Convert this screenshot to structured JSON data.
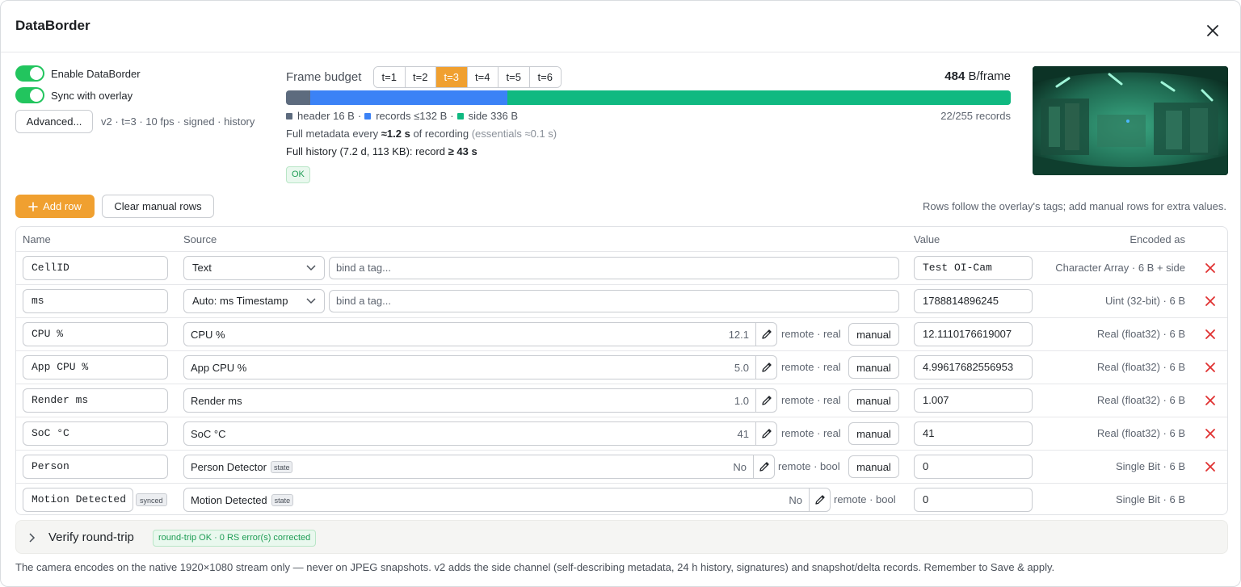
{
  "dialog": {
    "title": "DataBorder"
  },
  "toggles": {
    "enable_label": "Enable DataBorder",
    "sync_label": "Sync with overlay"
  },
  "advanced": {
    "button_label": "Advanced...",
    "summary": "v2 · t=3 · 10 fps · signed · history"
  },
  "frame_budget": {
    "label": "Frame budget",
    "tiers": [
      "t=1",
      "t=2",
      "t=3",
      "t=4",
      "t=5",
      "t=6"
    ],
    "selected_tier": "t=3",
    "total_value": "484",
    "total_unit": "B/frame",
    "bar_fractions": {
      "header": 0.033,
      "records": 0.273,
      "side": 0.694
    },
    "colors": {
      "header": "#5d6b7e",
      "records": "#3b82f6",
      "side": "#10b981"
    },
    "legend": {
      "header": "header 16 B",
      "records": "records ≤132 B",
      "side": "side 336 B"
    },
    "record_count": "22/255 records",
    "meta_prefix": "Full metadata every ",
    "meta_value": "≈1.2 s",
    "meta_mid": " of recording ",
    "meta_muted": "(essentials ≈0.1 s)",
    "history_prefix": "Full history (7.2 d, 113 KB): record ",
    "history_value": "≥ 43 s",
    "status": "OK"
  },
  "toolbar": {
    "add_label": "Add row",
    "clear_label": "Clear manual rows",
    "hint": "Rows follow the overlay's tags; add manual rows for extra values."
  },
  "table": {
    "headers": {
      "name": "Name",
      "source": "Source",
      "value": "Value",
      "encoded": "Encoded as"
    },
    "rows": [
      {
        "name": "CellID",
        "source": "Text",
        "bind_placeholder": "bind a tag...",
        "value": "Test OI-Cam",
        "encoded": "Character Array · 6 B + side"
      },
      {
        "name": "ms",
        "source": "Auto: ms Timestamp",
        "bind_placeholder": "bind a tag...",
        "value": "1788814896245",
        "encoded": "Uint (32-bit) · 6 B"
      },
      {
        "name": "CPU %",
        "source": "CPU %",
        "source_value": "12.1",
        "meta": "remote · real",
        "manual": "manual",
        "value": "12.1110176619007",
        "encoded": "Real (float32) · 6 B"
      },
      {
        "name": "App CPU %",
        "source": "App CPU %",
        "source_value": "5.0",
        "meta": "remote · real",
        "manual": "manual",
        "value": "4.99617682556953",
        "encoded": "Real (float32) · 6 B"
      },
      {
        "name": "Render ms",
        "source": "Render ms",
        "source_value": "1.0",
        "meta": "remote · real",
        "manual": "manual",
        "value": "1.007",
        "encoded": "Real (float32) · 6 B"
      },
      {
        "name": "SoC °C",
        "source": "SoC °C",
        "source_value": "41",
        "meta": "remote · real",
        "manual": "manual",
        "value": "41",
        "encoded": "Real (float32) · 6 B"
      },
      {
        "name": "Person",
        "source": "Person Detector",
        "state": "state",
        "source_value": "No",
        "meta": "remote · bool",
        "manual": "manual",
        "value": "0",
        "encoded": "Single Bit · 6 B"
      },
      {
        "name": "Motion Detected",
        "synced": "synced",
        "source": "Motion Detected",
        "state": "state",
        "source_value": "No",
        "meta": "remote · bool",
        "value": "0",
        "encoded": "Single Bit · 6 B"
      }
    ]
  },
  "verify": {
    "title": "Verify round-trip",
    "badge": "round-trip OK · 0 RS error(s) corrected"
  },
  "footnote": "The camera encodes on the native 1920×1080 stream only — never on JPEG snapshots. v2 adds the side channel (self-describing metadata, 24 h history, signatures) and snapshot/delta records. Remember to Save & apply.",
  "colors": {
    "accent": "#f0a030",
    "toggle_on": "#22c55e",
    "delete": "#e03131"
  }
}
